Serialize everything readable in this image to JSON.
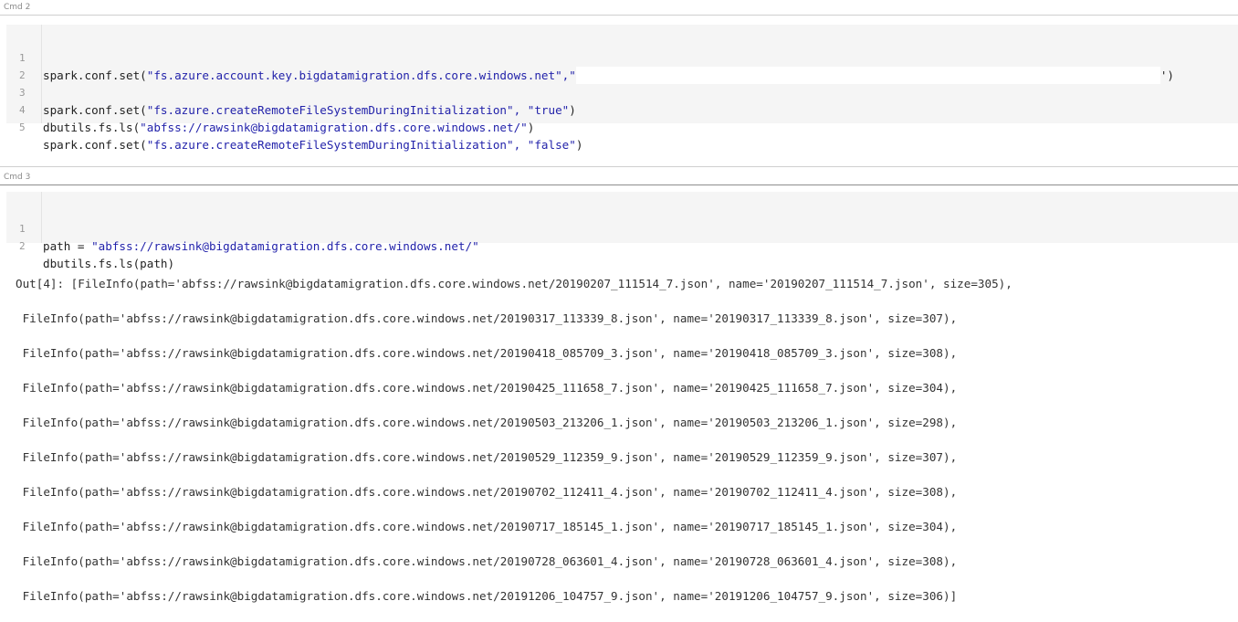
{
  "cells": [
    {
      "label": "Cmd 2",
      "lines": [
        {
          "n": "1",
          "pre": "spark.conf.set(",
          "str": "\"fs.azure.account.key.bigdatamigration.dfs.core.windows.net\",\"",
          "post": "",
          "tail": "')"
        },
        {
          "n": "2",
          "pre": "",
          "str": "",
          "post": ""
        },
        {
          "n": "3",
          "pre": "spark.conf.set(",
          "str": "\"fs.azure.createRemoteFileSystemDuringInitialization\", \"true\"",
          "post": ")"
        },
        {
          "n": "4",
          "pre": "dbutils.fs.ls(",
          "str": "\"abfss://rawsink@bigdatamigration.dfs.core.windows.net/\"",
          "post": ")"
        },
        {
          "n": "5",
          "pre": "spark.conf.set(",
          "str": "\"fs.azure.createRemoteFileSystemDuringInitialization\", \"false\"",
          "post": ")"
        }
      ]
    },
    {
      "label": "Cmd 3",
      "lines": [
        {
          "n": "1",
          "pre": "path = ",
          "str": "\"abfss://rawsink@bigdatamigration.dfs.core.windows.net/\"",
          "post": ""
        },
        {
          "n": "2",
          "pre": "dbutils.fs.ls(path)",
          "str": "",
          "post": ""
        }
      ]
    }
  ],
  "output": {
    "lines": [
      "Out[4]: [FileInfo(path='abfss://rawsink@bigdatamigration.dfs.core.windows.net/20190207_111514_7.json', name='20190207_111514_7.json', size=305),",
      " FileInfo(path='abfss://rawsink@bigdatamigration.dfs.core.windows.net/20190317_113339_8.json', name='20190317_113339_8.json', size=307),",
      " FileInfo(path='abfss://rawsink@bigdatamigration.dfs.core.windows.net/20190418_085709_3.json', name='20190418_085709_3.json', size=308),",
      " FileInfo(path='abfss://rawsink@bigdatamigration.dfs.core.windows.net/20190425_111658_7.json', name='20190425_111658_7.json', size=304),",
      " FileInfo(path='abfss://rawsink@bigdatamigration.dfs.core.windows.net/20190503_213206_1.json', name='20190503_213206_1.json', size=298),",
      " FileInfo(path='abfss://rawsink@bigdatamigration.dfs.core.windows.net/20190529_112359_9.json', name='20190529_112359_9.json', size=307),",
      " FileInfo(path='abfss://rawsink@bigdatamigration.dfs.core.windows.net/20190702_112411_4.json', name='20190702_112411_4.json', size=308),",
      " FileInfo(path='abfss://rawsink@bigdatamigration.dfs.core.windows.net/20190717_185145_1.json', name='20190717_185145_1.json', size=304),",
      " FileInfo(path='abfss://rawsink@bigdatamigration.dfs.core.windows.net/20190728_063601_4.json', name='20190728_063601_4.json', size=308),",
      " FileInfo(path='abfss://rawsink@bigdatamigration.dfs.core.windows.net/20191206_104757_9.json', name='20191206_104757_9.json', size=306)]"
    ]
  }
}
